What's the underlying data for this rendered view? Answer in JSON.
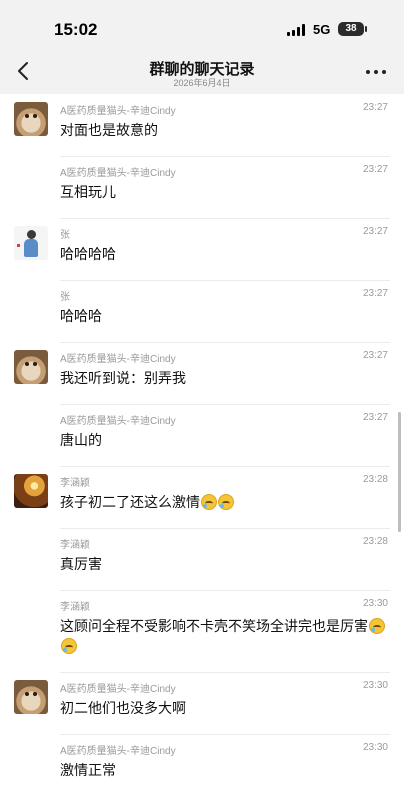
{
  "status_bar": {
    "time": "15:02",
    "network": "5G",
    "battery": "38"
  },
  "header": {
    "title": "群聊的聊天记录",
    "subtitle": "2026年6月4日",
    "back_icon": "chevron-left-icon",
    "more_icon": "more-dots-icon"
  },
  "messages": [
    {
      "sender": "A医药质量猫头-辛迪Cindy",
      "time": "23:27",
      "text": "对面也是故意的",
      "avatar": "hamster",
      "emoji_count": 0
    },
    {
      "sender": "A医药质量猫头-辛迪Cindy",
      "time": "23:27",
      "text": "互相玩儿",
      "avatar": "",
      "emoji_count": 0
    },
    {
      "sender": "张",
      "time": "23:27",
      "text": "哈哈哈哈",
      "avatar": "person",
      "emoji_count": 0
    },
    {
      "sender": "张",
      "time": "23:27",
      "text": "哈哈哈",
      "avatar": "",
      "emoji_count": 0
    },
    {
      "sender": "A医药质量猫头-辛迪Cindy",
      "time": "23:27",
      "text": "我还听到说：别弄我",
      "avatar": "hamster",
      "emoji_count": 0
    },
    {
      "sender": "A医药质量猫头-辛迪Cindy",
      "time": "23:27",
      "text": "唐山的",
      "avatar": "",
      "emoji_count": 0
    },
    {
      "sender": "李涵颖",
      "time": "23:28",
      "text": "孩子初二了还这么激情",
      "avatar": "autumn",
      "emoji_count": 2
    },
    {
      "sender": "李涵颖",
      "time": "23:28",
      "text": "真厉害",
      "avatar": "",
      "emoji_count": 0
    },
    {
      "sender": "李涵颖",
      "time": "23:30",
      "text": "这顾问全程不受影响不卡壳不笑场全讲完也是厉害",
      "avatar": "",
      "emoji_count": 2
    },
    {
      "sender": "A医药质量猫头-辛迪Cindy",
      "time": "23:30",
      "text": "初二他们也没多大啊",
      "avatar": "hamster",
      "emoji_count": 0
    },
    {
      "sender": "A医药质量猫头-辛迪Cindy",
      "time": "23:30",
      "text": "激情正常",
      "avatar": "",
      "emoji_count": 0
    }
  ]
}
